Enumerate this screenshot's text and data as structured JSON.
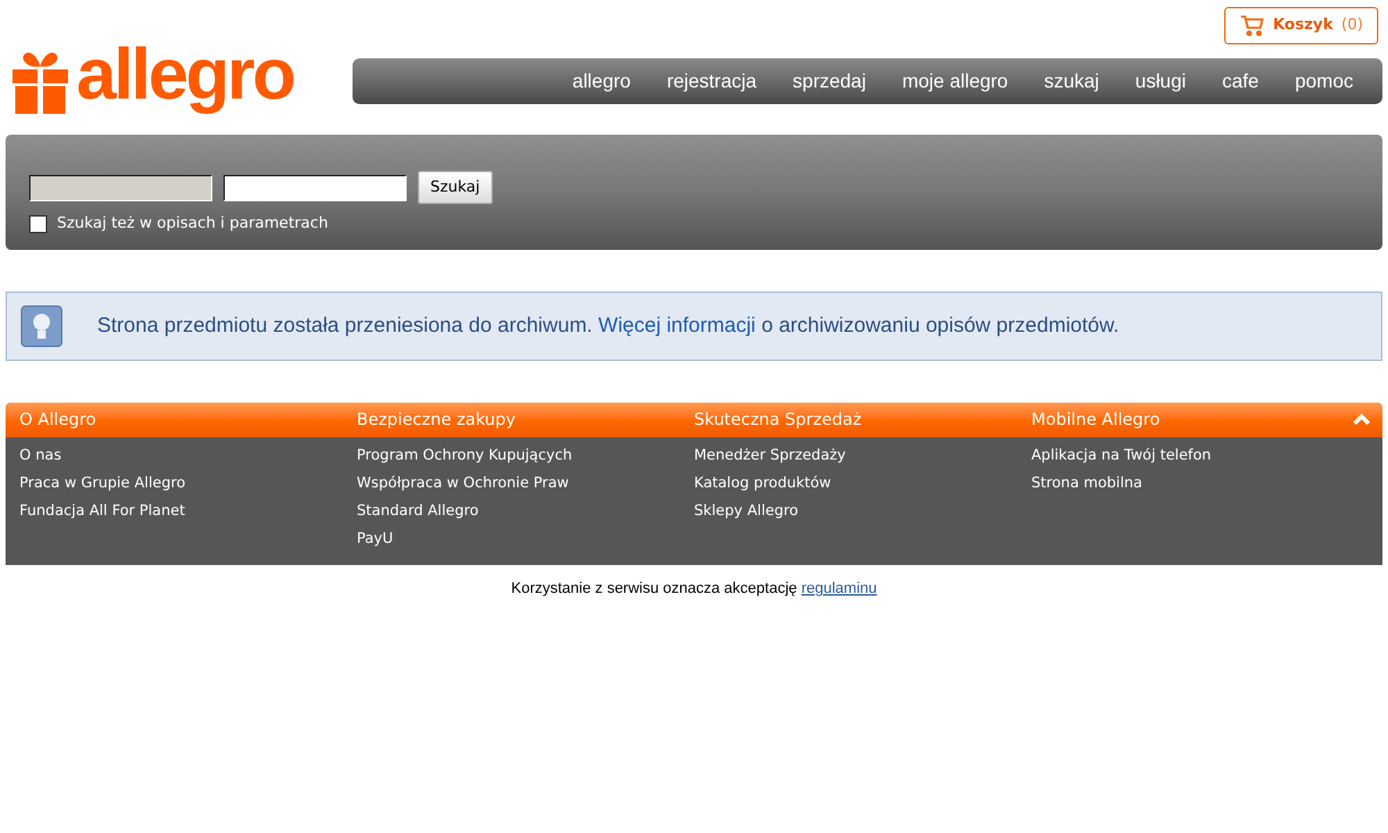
{
  "logo": "allegro",
  "cart": {
    "label": "Koszyk",
    "count": "(0)"
  },
  "nav": [
    "allegro",
    "rejestracja",
    "sprzedaj",
    "moje allegro",
    "szukaj",
    "usługi",
    "cafe",
    "pomoc"
  ],
  "search": {
    "button": "Szukaj",
    "checkbox": {
      "label": "Szukaj też w opisach i parametrach",
      "checked": false
    }
  },
  "notice": {
    "before": "Strona przedmiotu została przeniesiona do archiwum.",
    "link": "Więcej informacji",
    "after": "o archiwizowaniu opisów przedmiotów."
  },
  "footer_columns": [
    {
      "title": "O Allegro",
      "links": [
        "O nas",
        "Praca w Grupie Allegro",
        "Fundacja All For Planet"
      ]
    },
    {
      "title": "Bezpieczne zakupy",
      "links": [
        "Program Ochrony Kupujących",
        "Współpraca w Ochronie Praw",
        "Standard Allegro",
        "PayU"
      ]
    },
    {
      "title": "Skuteczna Sprzedaż",
      "links": [
        "Menedżer Sprzedaży",
        "Katalog produktów",
        "Sklepy Allegro"
      ]
    },
    {
      "title": "Mobilne Allegro",
      "links": [
        "Aplikacja na Twój telefon",
        "Strona mobilna"
      ]
    }
  ],
  "terms": {
    "text": "Korzystanie z serwisu oznacza akceptację",
    "link": "regulaminu"
  }
}
